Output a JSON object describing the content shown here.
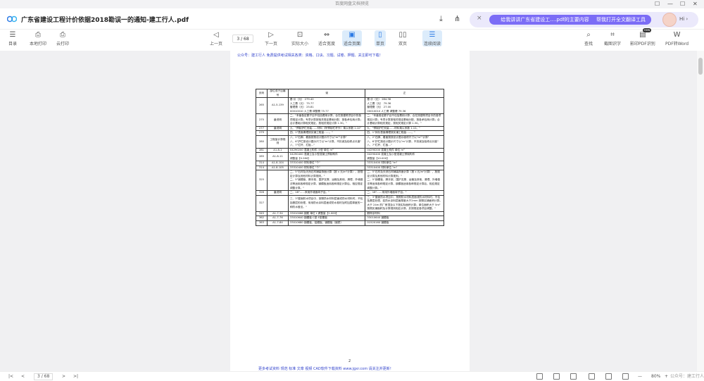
{
  "app": {
    "window_title": "百度网盘文档预览"
  },
  "window_controls": {
    "pin": "☐",
    "minimize": "—",
    "maximize": "☐",
    "close": "✕"
  },
  "header": {
    "doc_title": "广东省建设工程计价依据2018勘误一的通知-建工行人.pdf"
  },
  "ai_bar": {
    "close": "×",
    "button1": "给我讲讲广东省建设工….pdf的主要内容",
    "button2": "帮我打开全文翻译工具",
    "greeting": "Hi ›"
  },
  "toolbar": {
    "catalog": "目录",
    "local_print": "本地打印",
    "cloud_print": "云打印",
    "prev_page": "上一页",
    "page_input": "3 / 68",
    "next_page": "下一页",
    "actual_size": "实际大小",
    "fit_width": "适合宽度",
    "fit_page": "适合页面",
    "single_page": "单页",
    "double_page": "双页",
    "continuous": "连续阅读",
    "search": "查找",
    "screenshot_ocr": "截图识字",
    "scan_pdf": "影印PDF识别",
    "pdf_to_word": "PDF转Word",
    "new_badge": "new"
  },
  "page": {
    "header_text": "公众号：建工行人 免费提供考试相关各类：资格、口诀、习题、试卷、押题、关注即可下载！",
    "page_number": "2",
    "footer_text": "更多考试资料 规范 标准 文章 视频 CAD软件下载资料 www.jgxr.com 请关注并更新！"
  },
  "table": {
    "headers": [
      "页码",
      "部位或子目编号",
      "误",
      "正"
    ],
    "rows": [
      {
        "page": "265",
        "item": "A1-5-139",
        "wrong": "基  价（元）      279.40\n人工费（元）     75.77\n管理费（元）     25.81\n00010010 人工费 调整费 75.77",
        "right": "基  价（元）      284.38\n人工费（元）     79.36\n管理费（元）     27.00\n00010010 人工费 调整费 79.36"
      },
      {
        "page": "275",
        "item": "章说明",
        "wrong": "二、\"本章各定额子目不包括费用计算，合在按建筑项目中的各项规定计算；专项计算按相关规定基础分配、按各承包商计算；合计基础计算相关规定，按相关规定计算 1.30。\"",
        "right": "二、\"本章各定额子目不包括费用计算，合在按建筑项目中的各项规定计算；专项计算按相关规定基础分配、按各承包商计算；合计基础计算相关规定，按相关规定计算 1.30。\""
      },
      {
        "page": "277",
        "item": "章说明",
        "wrong": "九、\"预制护栏安装……材料（除预制栏杆外）乘以系数 1.10\"",
        "right": "九、\"预制护栏安装……材料乘以系数 1.10。\""
      },
      {
        "page": "279",
        "item": "",
        "wrong": "四、1\"表面清理按实铺工程量……。\"",
        "right": "四、1\"抹灰表面清理按实铺工程量……。\""
      },
      {
        "page": "280",
        "item": "工程量计算规则",
        "wrong": "八、2\"石脚、看面按按设计图示尺寸以\"m²\"计算\"\n八、6\"护栏按设计图示尺寸以\"m\"计算，不扣减及检修点长度\"\n八、7\"栏杆、栏板…\"",
        "right": "八、2\"石脚、看面按按设计图示面积尺寸以\"m²\"计算\"\n八、6\"护栏按设计图示尺寸以\"m\"计算，不扣减及检修点长度\"\n八、7\"栏杆、栏板…\""
      },
      {
        "page": "281",
        "item": "A1-8-1",
        "wrong": "04290200 混凝土构件 小型 单位 m³",
        "right": "04290200 混凝土构件 单位 m³"
      },
      {
        "page": "285",
        "item": "A1-8-11",
        "wrong": "04290400 混凝土及小型混凝土预制构件\n调整量【0.280】",
        "right": "04290400 混凝土及小型混凝土预制构件\n调整量【10.000】"
      },
      {
        "page": "314",
        "item": "A1-8-104",
        "wrong": "33310400 材料单位 \"个\"",
        "right": "33310400 材料单位 \"m\""
      },
      {
        "page": "314",
        "item": "A1-8-105",
        "wrong": "33310400 材料单位 \"个\"",
        "right": "33310400 材料单位 \"m\""
      },
      {
        "page": "325",
        "item": "",
        "wrong": "二、5\"石材及天然石材铺装饰面计算（按 x 元/m²计算），按规定计算及其他材料计算规则。\"\n二、5\"钢模板、脚手架、围护支撑、运输及其他、清理、外墙做法等适用各种规定计算，钢模板适用各种规定计算后，相应规定调整计算。\"",
        "right": "二、5\"石材及天然石材铺装饰面计算（按 x 元/m²计算），按规定计算及其他材料计算规则。\"\n二、5\"钢模板、脚手架、围护支撑、运输及其他、清理、外墙做法等适用各种规定计算，钢模板适用各种规定计算后，相应规定调整计算。\""
      },
      {
        "page": "326",
        "item": "章说明",
        "wrong": "二、18\"……采用外墙面砖子目。\"",
        "right": "二、18\"……采用外墙面砖子目。\""
      },
      {
        "page": "327",
        "item": "",
        "wrong": "三、3\"屋面防水项目中，按照防水材料层面或防水材料时，不包括基层的处理，采用防水涂料层面或防水卷材及附加层厚度的一种防水做法。\"",
        "right": "三、3\"屋面防水项目中，按照防水材料层面或防水材料时，不包括基层处理，若防水涂料层面厚度大于2mm 按照实铺面积计算，大于 24m 的厂房顶及以下按实际面积计算；单位面积大于 5m² 按照实铺面积及计算规则相应计算，并按规定各项目调整。\""
      },
      {
        "page": "345",
        "item": "A1-7-34",
        "wrong": "33010088 钢筋 单位 t 调整量【1.000】",
        "right": "删除该材料"
      },
      {
        "page": "362",
        "item": "A1-7-76",
        "wrong": "33010640 钢模板 C型 E型模板",
        "right": "33010640 钢模板"
      },
      {
        "page": "363",
        "item": "A1-7-84",
        "wrong": "33010680 钢模板、铝模板、钢模板（钢质）",
        "right": "01520160 钢模板"
      }
    ]
  },
  "statusbar": {
    "first": "|<",
    "prev": "<",
    "page_info": "3 / 68",
    "next": ">",
    "last": ">|",
    "zoom": "80%",
    "zoom_minus": "—",
    "zoom_plus": "+",
    "watermark": "公众号：建工行人"
  }
}
